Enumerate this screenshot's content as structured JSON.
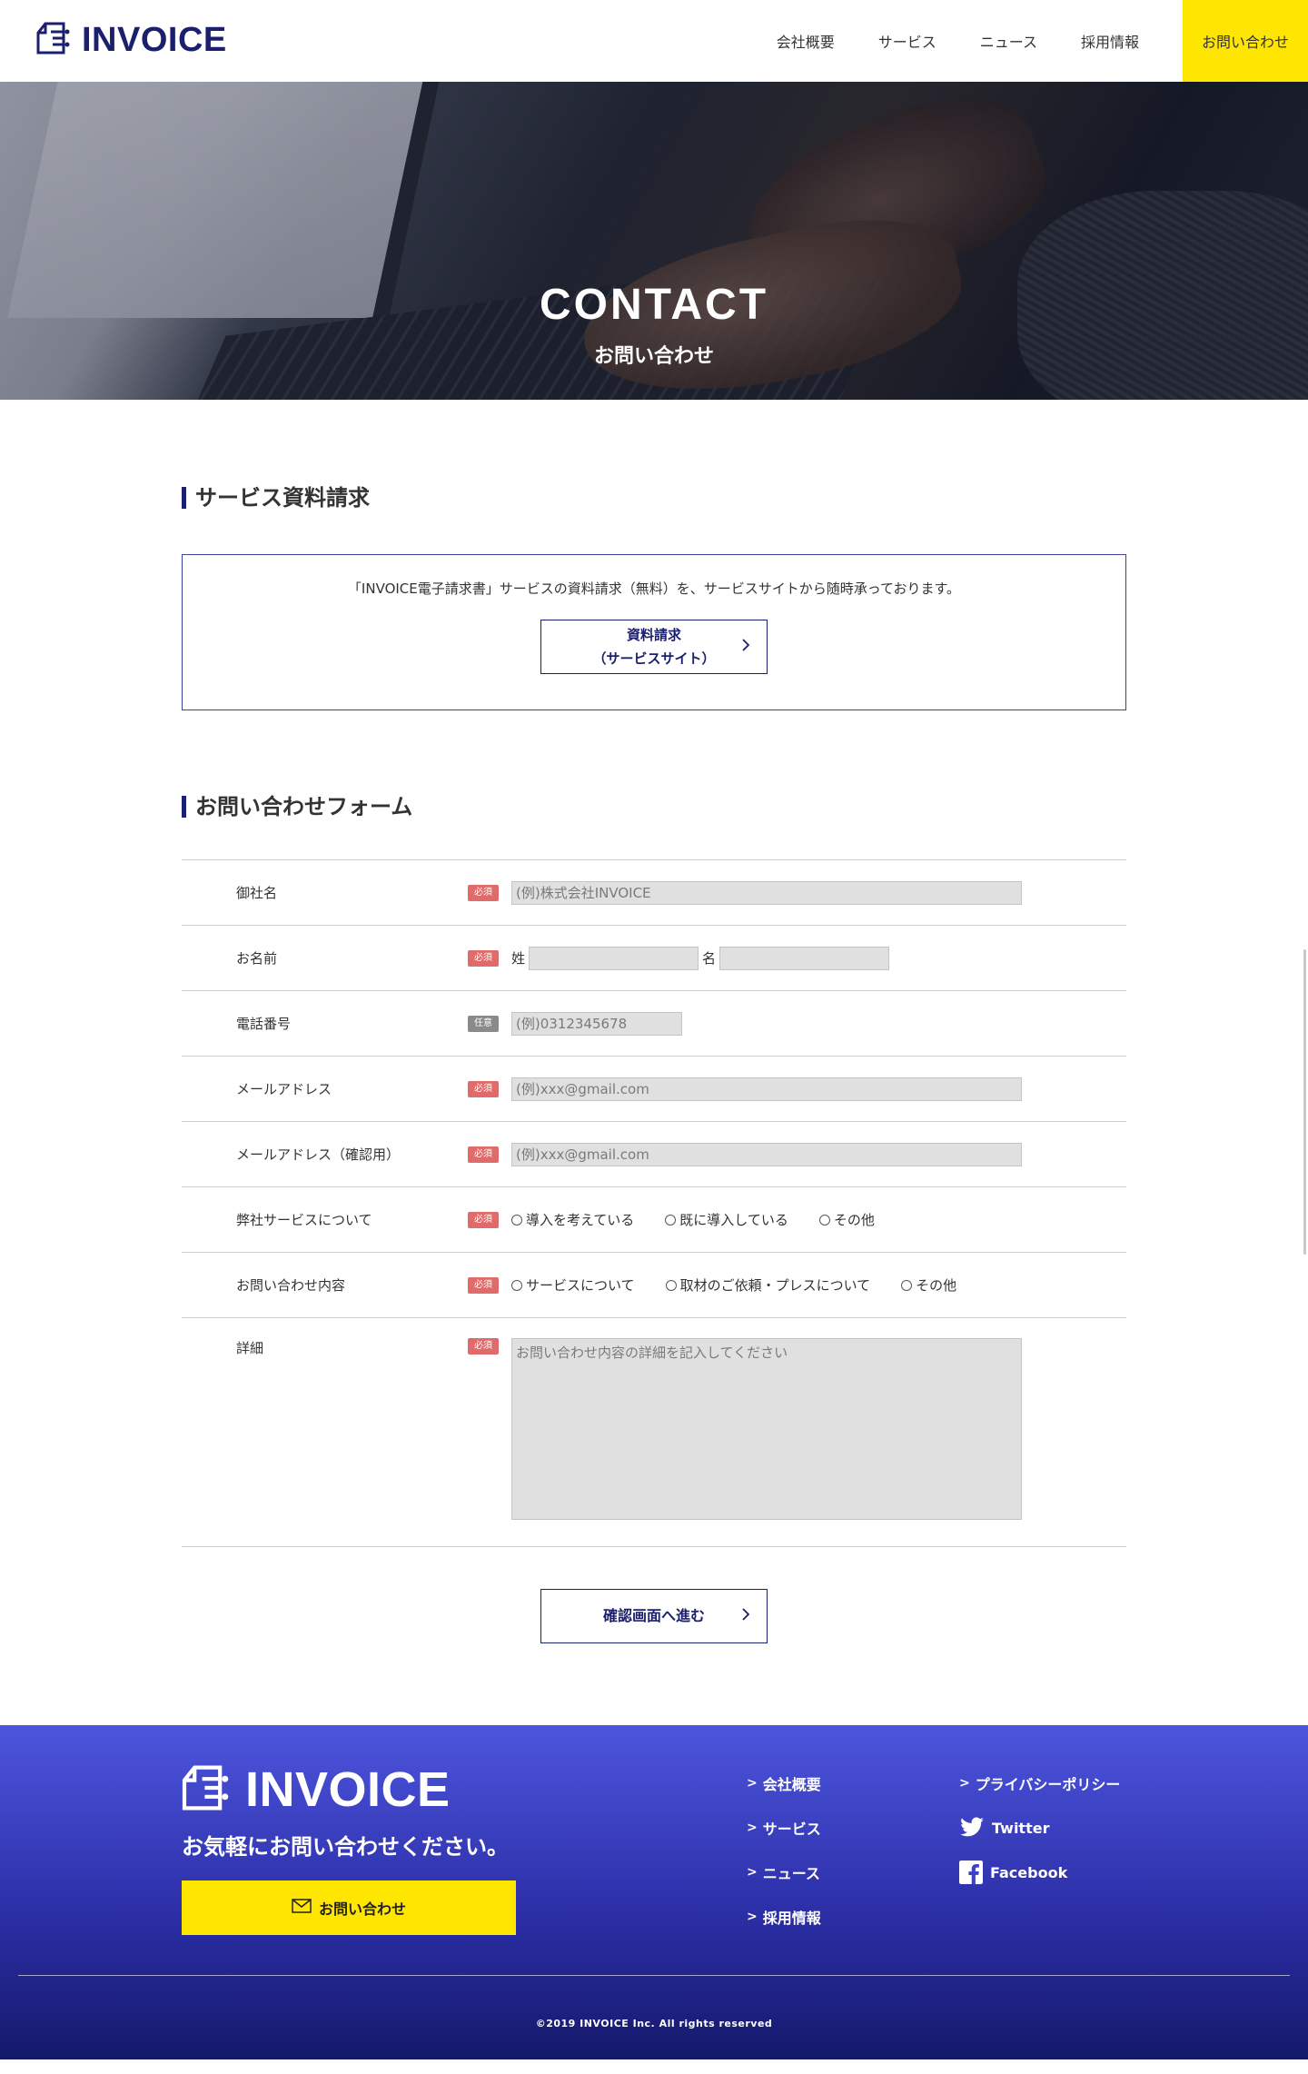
{
  "header": {
    "logo": "INVOICE",
    "nav": [
      "会社概要",
      "サービス",
      "ニュース",
      "採用情報"
    ],
    "cta": "お問い合わせ"
  },
  "hero": {
    "title": "CONTACT",
    "subtitle": "お問い合わせ"
  },
  "request": {
    "title": "サービス資料請求",
    "text": "「INVOICE電子請求書」サービスの資料請求（無料）を、サービスサイトから随時承っております。",
    "button_line1": "資料請求",
    "button_line2": "（サービスサイト）"
  },
  "form": {
    "title": "お問い合わせフォーム",
    "required_badge": "必須",
    "optional_badge": "任意",
    "rows": {
      "company": {
        "label": "御社名",
        "placeholder": "(例)株式会社INVOICE"
      },
      "name": {
        "label": "お名前",
        "last": "姓",
        "first": "名"
      },
      "phone": {
        "label": "電話番号",
        "placeholder": "(例)0312345678"
      },
      "email": {
        "label": "メールアドレス",
        "placeholder": "(例)xxx@gmail.com"
      },
      "email_confirm": {
        "label": "メールアドレス（確認用）",
        "placeholder": "(例)xxx@gmail.com"
      },
      "service": {
        "label": "弊社サービスについて",
        "options": [
          "導入を考えている",
          "既に導入している",
          "その他"
        ]
      },
      "inquiry": {
        "label": "お問い合わせ内容",
        "options": [
          "サービスについて",
          "取材のご依頼・プレスについて",
          "その他"
        ]
      },
      "detail": {
        "label": "詳細",
        "placeholder": "お問い合わせ内容の詳細を記入してください"
      }
    },
    "submit": "確認画面へ進む"
  },
  "footer": {
    "logo": "INVOICE",
    "tagline": "お気軽にお問い合わせください。",
    "cta": "お問い合わせ",
    "links_col1": [
      "会社概要",
      "サービス",
      "ニュース",
      "採用情報"
    ],
    "links_col2": {
      "privacy": "プライバシーポリシー",
      "twitter": "Twitter",
      "facebook": "Facebook"
    },
    "copyright": "©2019 INVOICE Inc. All rights reserved"
  },
  "colors": {
    "brand_navy": "#1a1f6e",
    "accent_yellow": "#ffe600",
    "required_red": "#e06b6b",
    "footer_blue": "#4d55dd"
  }
}
